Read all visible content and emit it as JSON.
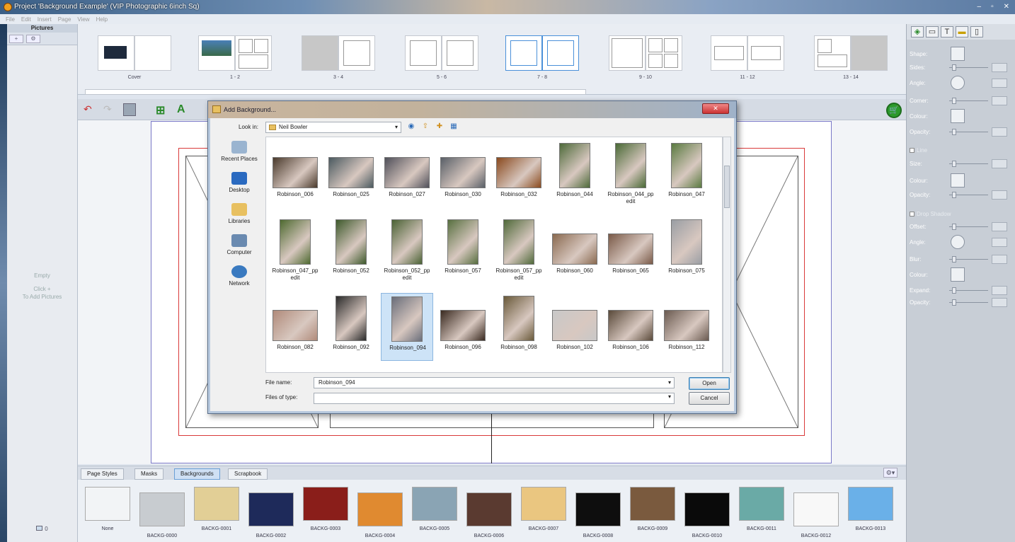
{
  "window": {
    "title": "Project 'Background Example' (VIP Photographic 6inch Sq)",
    "controls": [
      "–",
      "▫",
      "✕"
    ]
  },
  "menu": [
    "File",
    "Edit",
    "Insert",
    "Page",
    "View",
    "Help"
  ],
  "left_panel": {
    "header": "Pictures",
    "empty_title": "Empty",
    "empty_hint1": "Click +",
    "empty_hint2": "To Add Pictures",
    "count": "0",
    "add_icon": "+",
    "settings_icon": "⚙"
  },
  "spreads": [
    {
      "label": "Cover"
    },
    {
      "label": "1 - 2"
    },
    {
      "label": "3 - 4"
    },
    {
      "label": "5 - 6"
    },
    {
      "label": "7 - 8"
    },
    {
      "label": "9 - 10"
    },
    {
      "label": "11 - 12"
    },
    {
      "label": "13 - 14"
    }
  ],
  "dialog": {
    "title": "Add Background...",
    "close": "✕",
    "look_in_label": "Look in:",
    "look_in_value": "Neil Bowler",
    "places": [
      "Recent Places",
      "Desktop",
      "Libraries",
      "Computer",
      "Network"
    ],
    "files": [
      {
        "name": "Robinson_006",
        "color": "#4a3a2c",
        "orient": "land"
      },
      {
        "name": "Robinson_025",
        "color": "#4b5a60",
        "orient": "land"
      },
      {
        "name": "Robinson_027",
        "color": "#50505a",
        "orient": "land"
      },
      {
        "name": "Robinson_030",
        "color": "#5a6068",
        "orient": "land"
      },
      {
        "name": "Robinson_032",
        "color": "#8a4a1e",
        "orient": "land"
      },
      {
        "name": "Robinson_044",
        "color": "#4e6a3a",
        "orient": "port"
      },
      {
        "name": "Robinson_044_pp edit",
        "color": "#4a6a36",
        "orient": "port"
      },
      {
        "name": "Robinson_047",
        "color": "#5a7a40",
        "orient": "port"
      },
      {
        "name": "Robinson_047_pp edit",
        "color": "#4e6a30",
        "orient": "port"
      },
      {
        "name": "Robinson_052",
        "color": "#3e5a2c",
        "orient": "port"
      },
      {
        "name": "Robinson_052_pp edit",
        "color": "#4a6234",
        "orient": "port"
      },
      {
        "name": "Robinson_057",
        "color": "#587040",
        "orient": "port"
      },
      {
        "name": "Robinson_057_pp edit",
        "color": "#506a3a",
        "orient": "port"
      },
      {
        "name": "Robinson_060",
        "color": "#8a6a50",
        "orient": "land"
      },
      {
        "name": "Robinson_065",
        "color": "#7a5a48",
        "orient": "land"
      },
      {
        "name": "Robinson_075",
        "color": "#9a9ea4",
        "orient": "port"
      },
      {
        "name": "Robinson_082",
        "color": "#b08a7a",
        "orient": "land"
      },
      {
        "name": "Robinson_092",
        "color": "#2a2a2a",
        "orient": "port"
      },
      {
        "name": "Robinson_094",
        "color": "#6a6e7a",
        "orient": "port"
      },
      {
        "name": "Robinson_096",
        "color": "#3a2a20",
        "orient": "land"
      },
      {
        "name": "Robinson_098",
        "color": "#6a5a3a",
        "orient": "port"
      },
      {
        "name": "Robinson_102",
        "color": "#c8c8c8",
        "orient": "land"
      },
      {
        "name": "Robinson_106",
        "color": "#5a4a3a",
        "orient": "land"
      },
      {
        "name": "Robinson_112",
        "color": "#6a5a50",
        "orient": "land"
      }
    ],
    "selected_file": "Robinson_094",
    "file_name_label": "File name:",
    "file_name_value": "Robinson_094",
    "file_type_label": "Files of type:",
    "open_button": "Open",
    "cancel_button": "Cancel"
  },
  "tabs": [
    "Page Styles",
    "Masks",
    "Backgrounds",
    "Scrapbook"
  ],
  "active_tab": "Backgrounds",
  "backgrounds": [
    {
      "name": "None",
      "color": "#f2f4f6"
    },
    {
      "name": "BACKG-0000",
      "color": "#c8ccd0"
    },
    {
      "name": "BACKG-0001",
      "color": "#e2cf96"
    },
    {
      "name": "BACKG-0002",
      "color": "#1e2a5a"
    },
    {
      "name": "BACKG-0003",
      "color": "#8a1e1a"
    },
    {
      "name": "BACKG-0004",
      "color": "#e08a30"
    },
    {
      "name": "BACKG-0005",
      "color": "#8aa4b4"
    },
    {
      "name": "BACKG-0006",
      "color": "#5a3a30"
    },
    {
      "name": "BACKG-0007",
      "color": "#eac680"
    },
    {
      "name": "BACKG-0008",
      "color": "#0e0e0e"
    },
    {
      "name": "BACKG-0009",
      "color": "#7a5a3e"
    },
    {
      "name": "BACKG-0010",
      "color": "#0a0a0a"
    },
    {
      "name": "BACKG-0011",
      "color": "#6aaaa6"
    },
    {
      "name": "BACKG-0012",
      "color": "#f8f8f8"
    },
    {
      "name": "BACKG-0013",
      "color": "#6ab0e8"
    }
  ],
  "right_panel": {
    "shape": "Shape:",
    "sides": "Sides:",
    "angle": "Angle:",
    "corner": "Corner:",
    "colour": "Colour:",
    "opacity": "Opacity:",
    "line_header": "Line",
    "size": "Size:",
    "line_colour": "Colour:",
    "line_opacity": "Opacity:",
    "shadow_header": "Drop Shadow",
    "offset": "Offset:",
    "shadow_angle": "Angle:",
    "blur": "Blur:",
    "shadow_colour": "Colour:",
    "expand": "Expand:",
    "shadow_opacity": "Opacity:"
  },
  "accent_color": "#4a90d9",
  "page_border_color": "#7a78c8",
  "bleed_color": "#d93a3a"
}
